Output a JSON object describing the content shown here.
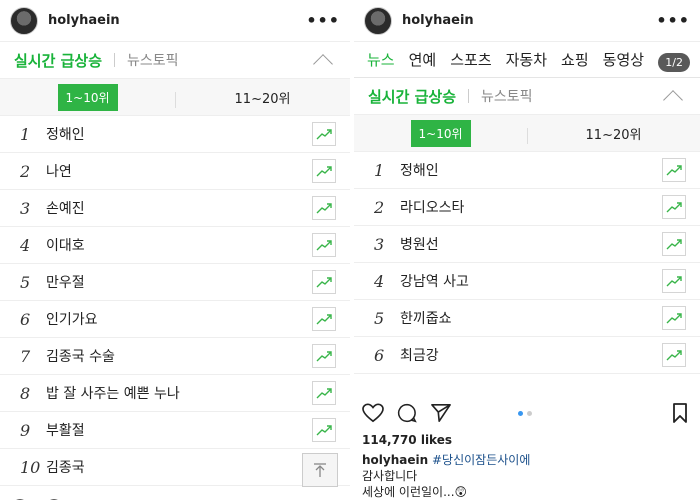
{
  "left": {
    "username": "holyhaein",
    "realtime_tab": "실시간 급상승",
    "news_topic_tab": "뉴스토픽",
    "range_active": "1~10위",
    "range_other": "11~20위",
    "ranks": [
      {
        "n": "1",
        "kw": "정해인"
      },
      {
        "n": "2",
        "kw": "나연"
      },
      {
        "n": "3",
        "kw": "손예진"
      },
      {
        "n": "4",
        "kw": "이대호"
      },
      {
        "n": "5",
        "kw": "만우절"
      },
      {
        "n": "6",
        "kw": "인기가요"
      },
      {
        "n": "7",
        "kw": "김종국 수술"
      },
      {
        "n": "8",
        "kw": "밥 잘 사주는 예쁜 누나"
      },
      {
        "n": "9",
        "kw": "부활절"
      },
      {
        "n": "10",
        "kw": "김종국"
      }
    ]
  },
  "right": {
    "username": "holyhaein",
    "nav": [
      "뉴스",
      "연예",
      "스포츠",
      "자동차",
      "쇼핑",
      "동영상"
    ],
    "pager": "1/2",
    "realtime_tab": "실시간 급상승",
    "news_topic_tab": "뉴스토픽",
    "range_active": "1~10위",
    "range_other": "11~20위",
    "ranks": [
      {
        "n": "1",
        "kw": "정해인"
      },
      {
        "n": "2",
        "kw": "라디오스타"
      },
      {
        "n": "3",
        "kw": "병원선"
      },
      {
        "n": "4",
        "kw": "강남역 사고"
      },
      {
        "n": "5",
        "kw": "한끼줍쇼"
      },
      {
        "n": "6",
        "kw": "최금강"
      }
    ],
    "likes": "114,770 likes",
    "caption_user": "holyhaein",
    "caption_tag": "#당신이잠든사이에",
    "caption_line2": "감사합니다",
    "caption_line3": "세상에 이런일이...😲"
  },
  "colors": {
    "accent": "#19b33a",
    "pill": "#2fb445",
    "link": "#1a4f8a"
  },
  "icons": [
    "more-icon",
    "chevron-up-icon",
    "trend-chart-icon",
    "scroll-top-icon",
    "heart-icon",
    "comment-icon",
    "share-icon",
    "bookmark-icon"
  ]
}
